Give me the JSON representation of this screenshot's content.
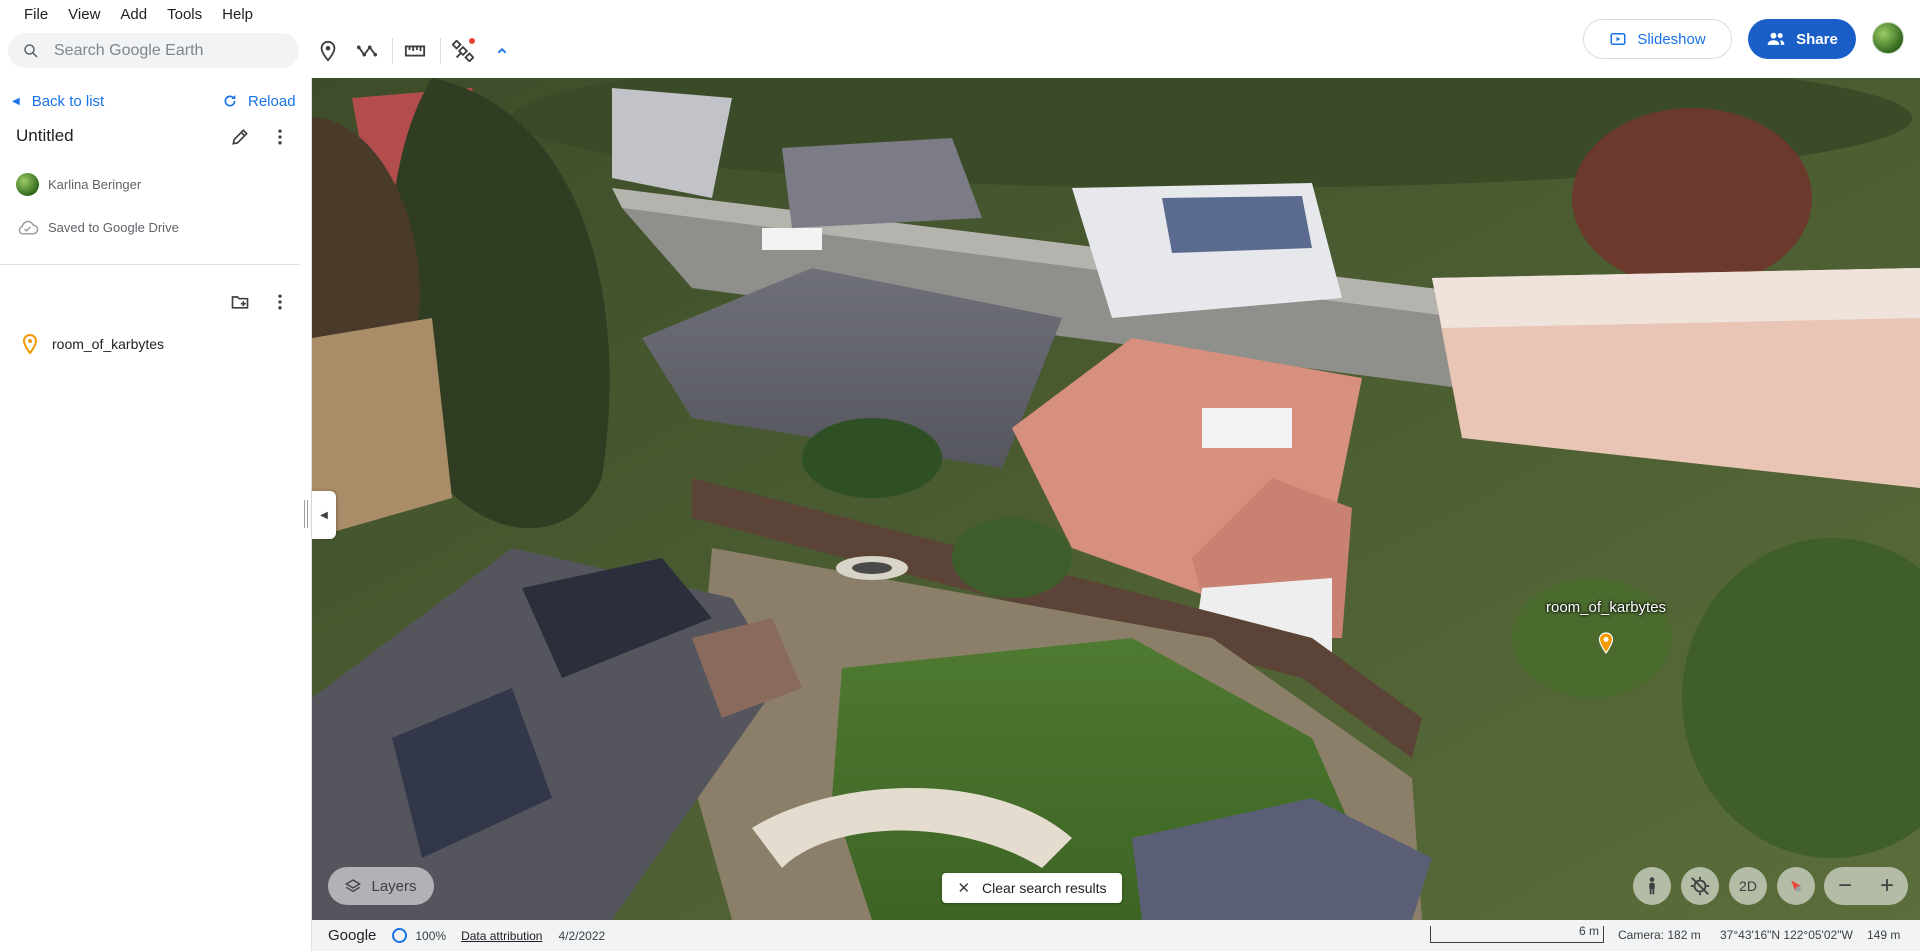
{
  "menu": [
    "File",
    "View",
    "Add",
    "Tools",
    "Help"
  ],
  "search": {
    "placeholder": "Search Google Earth"
  },
  "toolbar_icons": [
    "placemark-icon",
    "path-icon",
    "ruler-icon",
    "satellite-icon",
    "collapse-up-icon"
  ],
  "header": {
    "slideshow_label": "Slideshow",
    "share_label": "Share"
  },
  "sidebar": {
    "back_label": "Back to list",
    "reload_label": "Reload",
    "project_title": "Untitled",
    "owner": "Karlina Beringer",
    "saved_status": "Saved to Google Drive",
    "features": [
      {
        "name": "room_of_karbytes",
        "icon": "placemark-icon"
      }
    ]
  },
  "map": {
    "placemark_label": "room_of_karbytes",
    "layers_label": "Layers",
    "clear_search_label": "Clear search results",
    "view_mode_label": "2D",
    "zoom_out": "−",
    "zoom_in": "+"
  },
  "status": {
    "logo": "Google",
    "load_percent": "100%",
    "attribution": "Data attribution",
    "imagery_date": "4/2/2022",
    "scale": "6 m",
    "camera": "Camera: 182 m",
    "coordinates": "37°43'16\"N 122°05'02\"W",
    "elevation": "149 m"
  },
  "colors": {
    "accent": "#1a73e8",
    "share_bg": "#1a5fc8",
    "placemark": "#f29900"
  }
}
